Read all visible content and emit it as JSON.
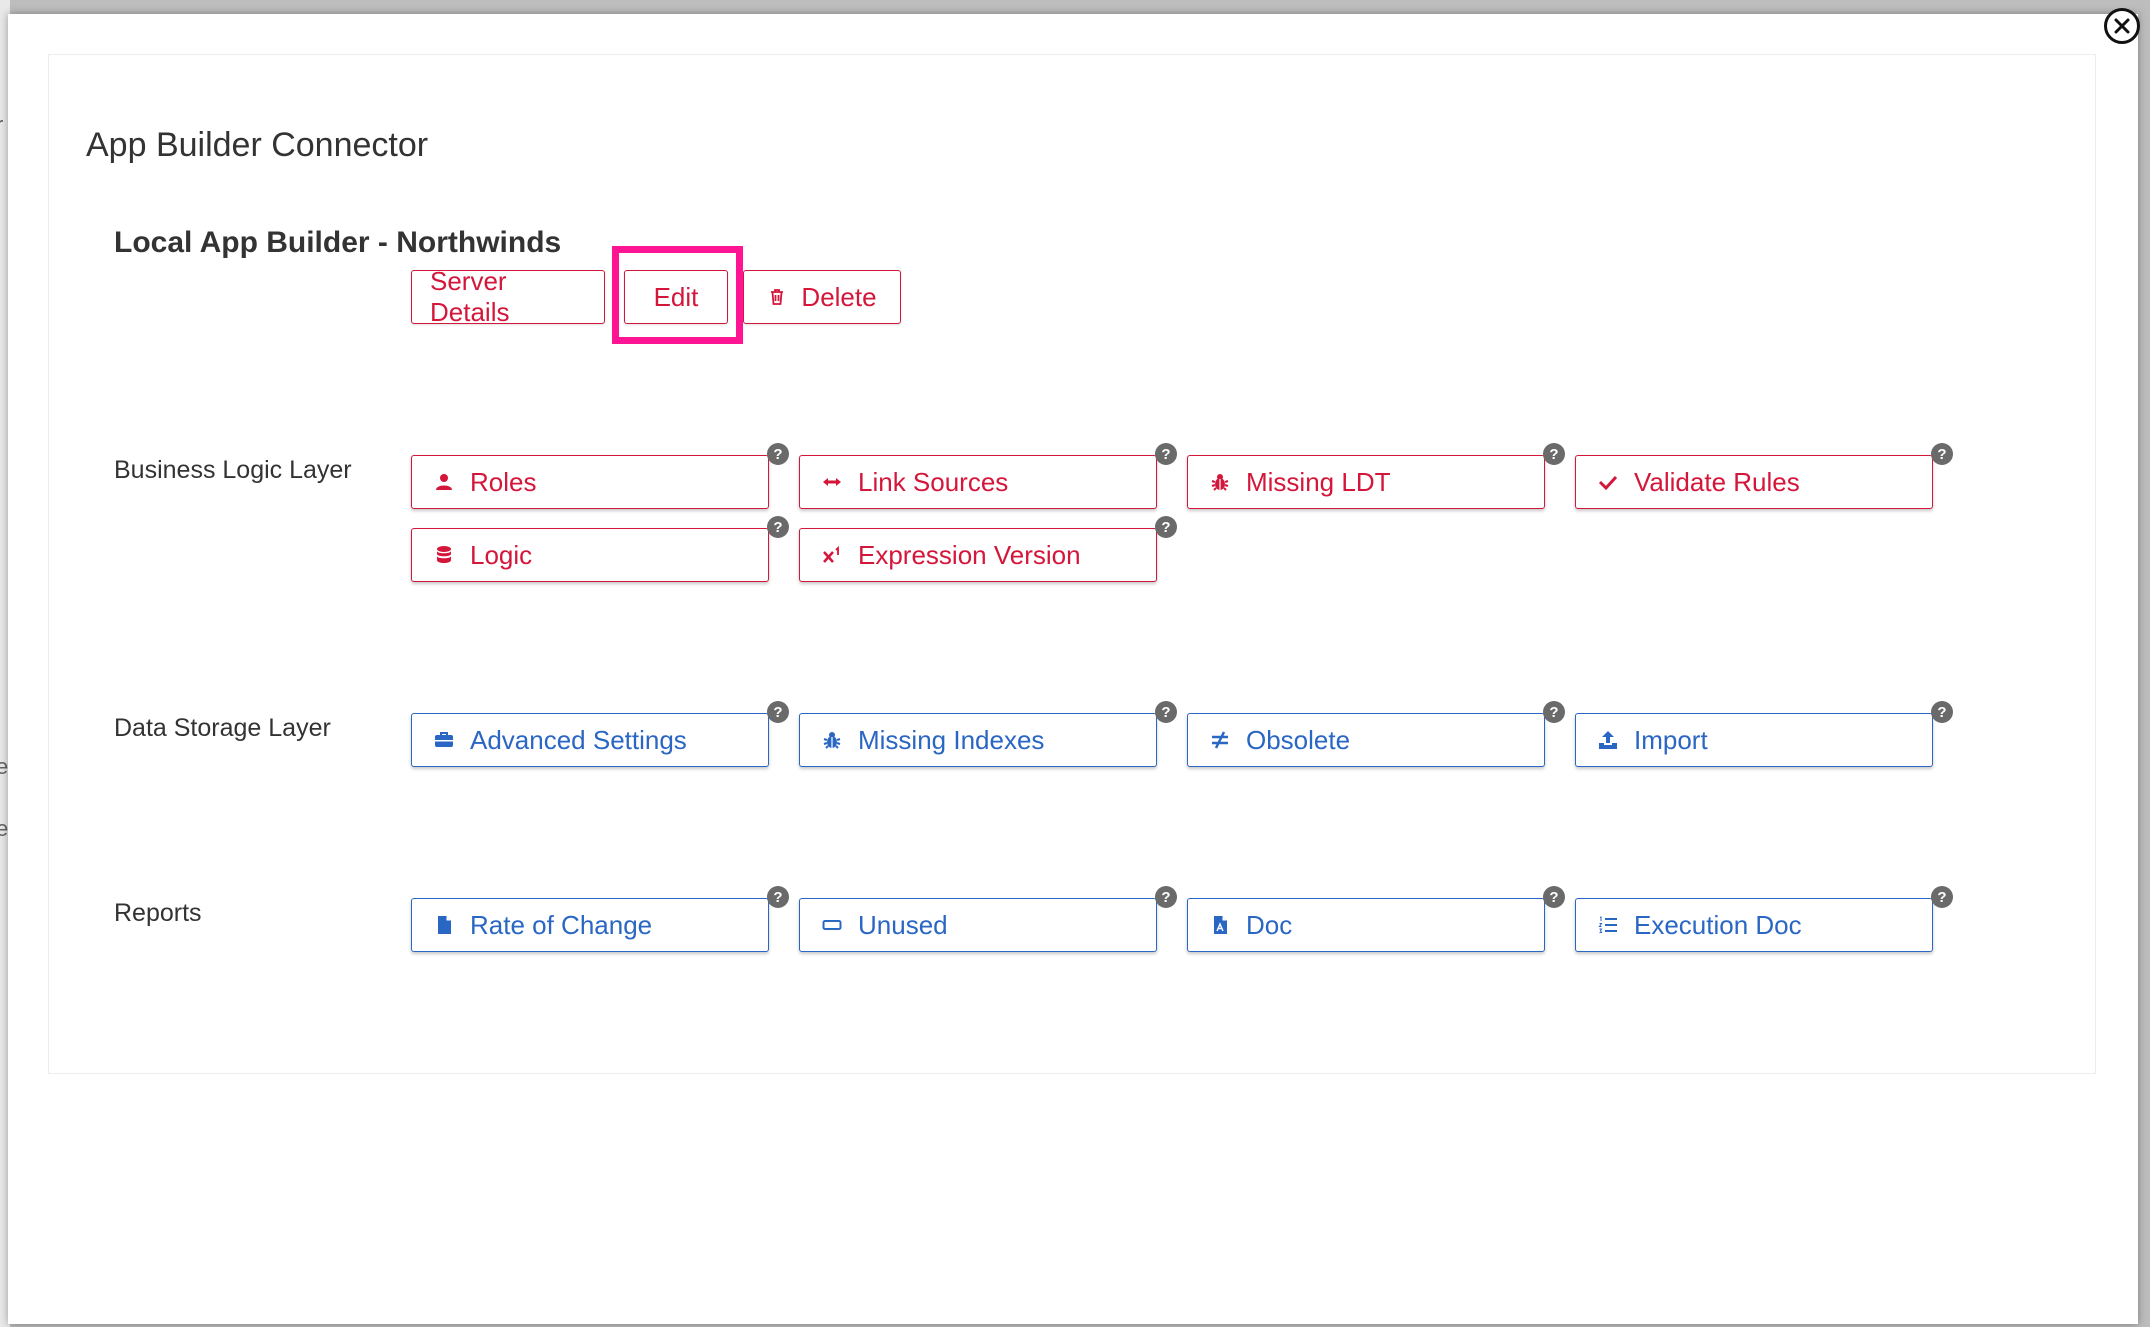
{
  "background": {
    "letters": [
      "r",
      "e",
      "e"
    ]
  },
  "modal": {
    "title": "App Builder Connector",
    "close_icon": "close-icon"
  },
  "connector": {
    "name": "Local App Builder - Northwinds",
    "actions": {
      "server_details": "Server Details",
      "edit": "Edit",
      "delete": "Delete"
    }
  },
  "sections": {
    "business_logic": {
      "label": "Business Logic Layer",
      "buttons": [
        "Roles",
        "Link Sources",
        "Missing LDT",
        "Validate Rules",
        "Logic",
        "Expression Version"
      ],
      "icons": [
        "user-icon",
        "arrows-h-icon",
        "bug-icon",
        "check-icon",
        "database-icon",
        "superscript-icon"
      ]
    },
    "data_storage": {
      "label": "Data Storage Layer",
      "buttons": [
        "Advanced Settings",
        "Missing Indexes",
        "Obsolete",
        "Import"
      ],
      "icons": [
        "briefcase-icon",
        "bug-icon",
        "not-equal-icon",
        "upload-icon"
      ]
    },
    "reports": {
      "label": "Reports",
      "buttons": [
        "Rate of Change",
        "Unused",
        "Doc",
        "Execution Doc"
      ],
      "icons": [
        "file-icon",
        "rectangle-icon",
        "pdf-file-icon",
        "list-ol-icon"
      ]
    }
  },
  "help_label": "?",
  "colors": {
    "red_accent": "#d5163b",
    "blue_accent": "#2a66c4",
    "highlight": "#ff1493",
    "help_badge": "#6a6a6a"
  }
}
